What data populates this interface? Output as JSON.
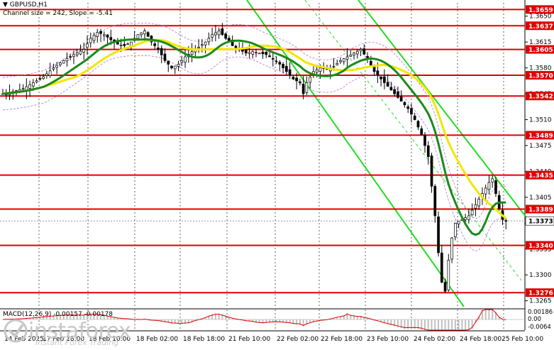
{
  "header": {
    "symbol": "GBPUSD,H1",
    "channel_info": "Channel size = 242, Slope = -5.41"
  },
  "macd": {
    "label": "MACD(12,26,9) -0.00157 -0.00178",
    "scale_labels": [
      "0.00186",
      "0.00",
      "-0.0064"
    ]
  },
  "watermark": {
    "name": "instaforex",
    "tagline": "Instant Forex Trading"
  },
  "price_axis": {
    "ticks": [
      "1.3650",
      "1.3615",
      "1.3580",
      "1.3545",
      "1.3510",
      "1.3475",
      "1.3440",
      "1.3405",
      "1.3370",
      "1.3335",
      "1.3300",
      "1.3265"
    ]
  },
  "levels": [
    {
      "price": 1.3659,
      "label": "1.3659"
    },
    {
      "price": 1.3637,
      "label": "1.3637"
    },
    {
      "price": 1.3605,
      "label": "1.3605"
    },
    {
      "price": 1.357,
      "label": "1.3570"
    },
    {
      "price": 1.3542,
      "label": "1.3542"
    },
    {
      "price": 1.3489,
      "label": "1.3489"
    },
    {
      "price": 1.3435,
      "label": "1.3435"
    },
    {
      "price": 1.3389,
      "label": "1.3389"
    },
    {
      "price": 1.334,
      "label": "1.3340"
    },
    {
      "price": 1.3276,
      "label": "1.3276"
    }
  ],
  "current_price": {
    "price": 1.3373,
    "label": "1.3373"
  },
  "time_axis": {
    "labels": [
      "14 Feb 2025",
      "17 Feb 18:00",
      "18 Feb 10:00",
      "18 Feb 02:00",
      "18 Feb 18:00",
      "21 Feb 10:00",
      "22 Feb 02:00",
      "22 Feb 18:00",
      "23 Feb 10:00",
      "24 Feb 02:00",
      "24 Feb 18:00",
      "25 Feb 10:00"
    ]
  },
  "colors": {
    "level_line": "#e00000",
    "level_label_bg": "#e00000",
    "ma_fast": "#1a8a1a",
    "ma_slow": "#f2e600",
    "channel": "#22dd22",
    "envelope": "#b070d0",
    "grid": "#000000",
    "candle": "#000000",
    "macd_hist": "#c0c0c0",
    "macd_signal": "#e00000"
  },
  "chart_data": {
    "type": "candlestick",
    "symbol": "GBPUSD",
    "timeframe": "H1",
    "ylim": [
      1.3257,
      1.3668
    ],
    "close_path": [
      [
        0,
        1.3545
      ],
      [
        6,
        1.3548
      ],
      [
        12,
        1.3552
      ],
      [
        18,
        1.356
      ],
      [
        24,
        1.3568
      ],
      [
        30,
        1.358
      ],
      [
        36,
        1.359
      ],
      [
        42,
        1.3598
      ],
      [
        48,
        1.3605
      ],
      [
        52,
        1.362
      ],
      [
        56,
        1.3628
      ],
      [
        60,
        1.3625
      ],
      [
        64,
        1.3618
      ],
      [
        68,
        1.3612
      ],
      [
        72,
        1.361
      ],
      [
        76,
        1.3615
      ],
      [
        80,
        1.3625
      ],
      [
        84,
        1.363
      ],
      [
        88,
        1.3615
      ],
      [
        92,
        1.3605
      ],
      [
        96,
        1.359
      ],
      [
        100,
        1.358
      ],
      [
        104,
        1.3585
      ],
      [
        108,
        1.3595
      ],
      [
        112,
        1.3602
      ],
      [
        116,
        1.3608
      ],
      [
        120,
        1.3615
      ],
      [
        124,
        1.3625
      ],
      [
        128,
        1.363
      ],
      [
        132,
        1.362
      ],
      [
        136,
        1.361
      ],
      [
        140,
        1.3605
      ],
      [
        144,
        1.36
      ],
      [
        148,
        1.3602
      ],
      [
        152,
        1.36
      ],
      [
        156,
        1.3598
      ],
      [
        160,
        1.3592
      ],
      [
        164,
        1.3585
      ],
      [
        168,
        1.3575
      ],
      [
        172,
        1.3565
      ],
      [
        176,
        1.356
      ],
      [
        178,
        1.3545
      ],
      [
        180,
        1.356
      ],
      [
        184,
        1.3575
      ],
      [
        188,
        1.358
      ],
      [
        192,
        1.3578
      ],
      [
        196,
        1.3582
      ],
      [
        200,
        1.359
      ],
      [
        204,
        1.3595
      ],
      [
        208,
        1.36
      ],
      [
        212,
        1.3605
      ],
      [
        216,
        1.3592
      ],
      [
        220,
        1.3575
      ],
      [
        224,
        1.3565
      ],
      [
        228,
        1.3555
      ],
      [
        232,
        1.3545
      ],
      [
        236,
        1.3535
      ],
      [
        240,
        1.3525
      ],
      [
        244,
        1.351
      ],
      [
        248,
        1.349
      ],
      [
        252,
        1.346
      ],
      [
        254,
        1.342
      ],
      [
        256,
        1.338
      ],
      [
        258,
        1.333
      ],
      [
        260,
        1.329
      ],
      [
        262,
        1.3278
      ],
      [
        264,
        1.332
      ],
      [
        266,
        1.335
      ],
      [
        268,
        1.337
      ],
      [
        272,
        1.3375
      ],
      [
        276,
        1.338
      ],
      [
        280,
        1.3395
      ],
      [
        284,
        1.341
      ],
      [
        288,
        1.3425
      ],
      [
        290,
        1.343
      ],
      [
        292,
        1.341
      ],
      [
        294,
        1.339
      ],
      [
        296,
        1.3375
      ],
      [
        298,
        1.3373
      ]
    ]
  }
}
